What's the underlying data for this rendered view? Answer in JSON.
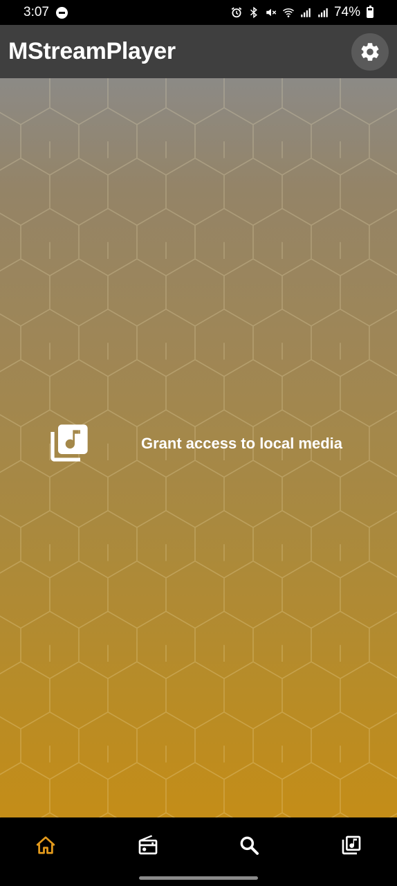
{
  "status_bar": {
    "time": "3:07",
    "battery": "74%",
    "icons": [
      "do-not-disturb-icon",
      "alarm-icon",
      "bluetooth-icon",
      "mute-icon",
      "wifi-icon",
      "signal-icon",
      "signal-2-icon",
      "battery-icon"
    ]
  },
  "app_bar": {
    "title": "MStreamPlayer",
    "settings_icon": "gear-icon"
  },
  "main": {
    "grant_label": "Grant access to local media",
    "grant_icon": "library-music-icon"
  },
  "bottom_nav": {
    "items": [
      {
        "icon": "home-icon",
        "active": true
      },
      {
        "icon": "radio-icon",
        "active": false
      },
      {
        "icon": "search-icon",
        "active": false
      },
      {
        "icon": "library-music-icon",
        "active": false
      }
    ],
    "active_color": "#e39a1c",
    "inactive_color": "#ffffff"
  },
  "colors": {
    "app_bar": "#3f3f3f",
    "accent": "#e39a1c"
  }
}
